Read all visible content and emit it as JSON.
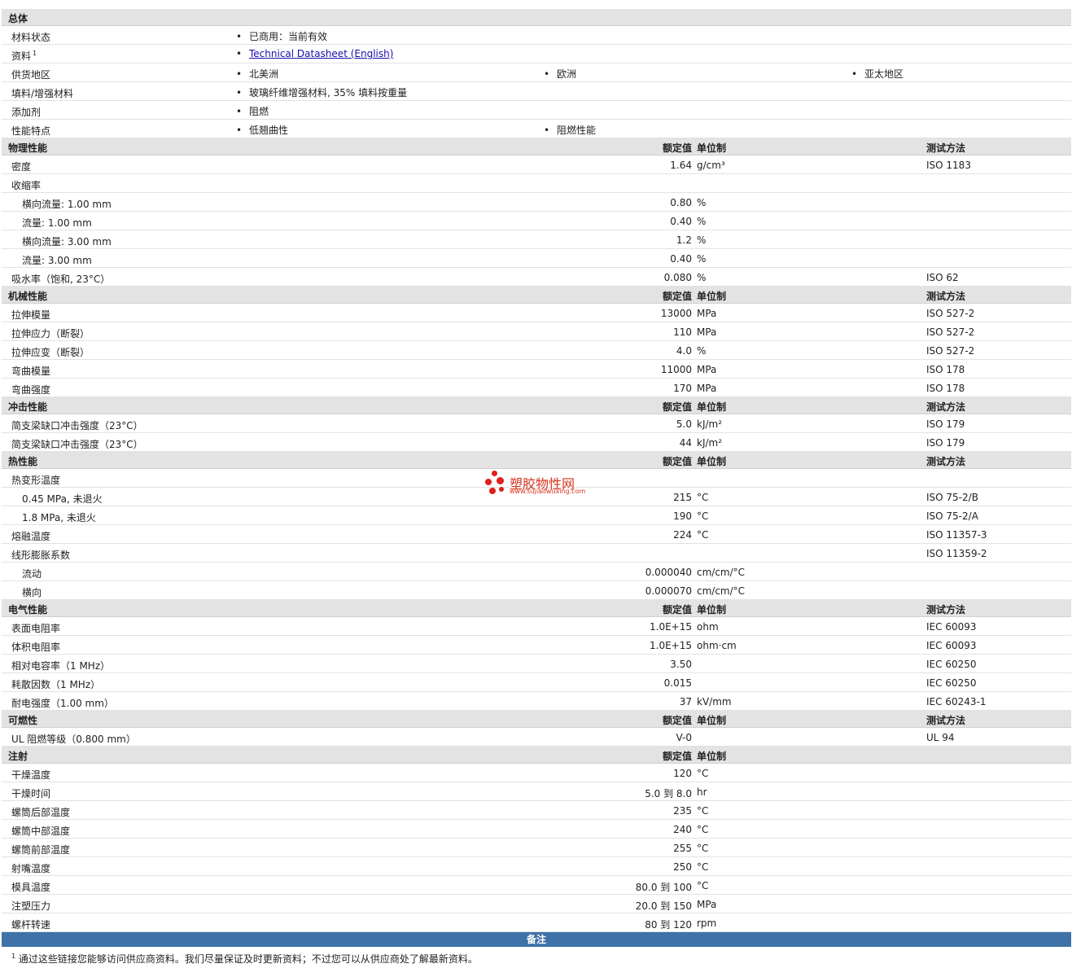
{
  "general": {
    "section": "总体",
    "status_label": "材料状态",
    "status_value": "已商用：当前有效",
    "doc_label": "资料",
    "doc_sup": "1",
    "doc_link": "Technical Datasheet (English)",
    "region_label": "供货地区",
    "regions": [
      "北美洲",
      "欧洲",
      "亚太地区"
    ],
    "filler_label": "填料/增强材料",
    "filler_value": "玻璃纤维增强材料, 35% 填料按重量",
    "additive_label": "添加剂",
    "additive_value": "阻燃",
    "feature_label": "性能特点",
    "features": [
      "低翘曲性",
      "阻燃性能"
    ]
  },
  "headers": {
    "value": "额定值",
    "unit": "单位制",
    "method": "测试方法"
  },
  "physical": {
    "section": "物理性能",
    "rows": [
      {
        "label": "密度",
        "value": "1.64",
        "unit": "g/cm³",
        "method": "ISO 1183"
      },
      {
        "label": "收缩率",
        "value": "",
        "unit": "",
        "method": ""
      },
      {
        "label": "横向流量: 1.00 mm",
        "value": "0.80",
        "unit": "%",
        "method": ""
      },
      {
        "label": "流量: 1.00 mm",
        "value": "0.40",
        "unit": "%",
        "method": ""
      },
      {
        "label": "横向流量: 3.00 mm",
        "value": "1.2",
        "unit": "%",
        "method": ""
      },
      {
        "label": "流量: 3.00 mm",
        "value": "0.40",
        "unit": "%",
        "method": ""
      },
      {
        "label": "吸水率（饱和, 23°C）",
        "value": "0.080",
        "unit": "%",
        "method": "ISO 62"
      }
    ]
  },
  "mechanical": {
    "section": "机械性能",
    "rows": [
      {
        "label": "拉伸模量",
        "value": "13000",
        "unit": "MPa",
        "method": "ISO 527-2"
      },
      {
        "label": "拉伸应力（断裂）",
        "value": "110",
        "unit": "MPa",
        "method": "ISO 527-2"
      },
      {
        "label": "拉伸应变（断裂）",
        "value": "4.0",
        "unit": "%",
        "method": "ISO 527-2"
      },
      {
        "label": "弯曲模量",
        "value": "11000",
        "unit": "MPa",
        "method": "ISO 178"
      },
      {
        "label": "弯曲强度",
        "value": "170",
        "unit": "MPa",
        "method": "ISO 178"
      }
    ]
  },
  "impact": {
    "section": "冲击性能",
    "rows": [
      {
        "label": "简支梁缺口冲击强度（23°C）",
        "value": "5.0",
        "unit": "kJ/m²",
        "method": "ISO 179"
      },
      {
        "label": "简支梁缺口冲击强度（23°C）",
        "value": "44",
        "unit": "kJ/m²",
        "method": "ISO 179"
      }
    ]
  },
  "thermal": {
    "section": "热性能",
    "rows": [
      {
        "label": "热变形温度",
        "value": "",
        "unit": "",
        "method": ""
      },
      {
        "label": "0.45 MPa, 未退火",
        "value": "215",
        "unit": "°C",
        "method": "ISO 75-2/B"
      },
      {
        "label": "1.8 MPa, 未退火",
        "value": "190",
        "unit": "°C",
        "method": "ISO 75-2/A"
      },
      {
        "label": "熔融温度",
        "value": "224",
        "unit": "°C",
        "method": "ISO 11357-3"
      },
      {
        "label": "线形膨胀系数",
        "value": "",
        "unit": "",
        "method": "ISO 11359-2"
      },
      {
        "label": "流动",
        "value": "0.000040",
        "unit": "cm/cm/°C",
        "method": ""
      },
      {
        "label": "横向",
        "value": "0.000070",
        "unit": "cm/cm/°C",
        "method": ""
      }
    ]
  },
  "electrical": {
    "section": "电气性能",
    "rows": [
      {
        "label": "表面电阻率",
        "value": "1.0E+15",
        "unit": "ohm",
        "method": "IEC 60093"
      },
      {
        "label": "体积电阻率",
        "value": "1.0E+15",
        "unit": "ohm·cm",
        "method": "IEC 60093"
      },
      {
        "label": "相对电容率（1 MHz）",
        "value": "3.50",
        "unit": "",
        "method": "IEC 60250"
      },
      {
        "label": "耗散因数（1 MHz）",
        "value": "0.015",
        "unit": "",
        "method": "IEC 60250"
      },
      {
        "label": "耐电强度（1.00 mm）",
        "value": "37",
        "unit": "kV/mm",
        "method": "IEC 60243-1"
      }
    ]
  },
  "flammability": {
    "section": "可燃性",
    "rows": [
      {
        "label": "UL 阻燃等级（0.800 mm）",
        "value": "V-0",
        "unit": "",
        "method": "UL 94"
      }
    ]
  },
  "injection": {
    "section": "注射",
    "rows": [
      {
        "label": "干燥温度",
        "value": "120",
        "unit": "°C"
      },
      {
        "label": "干燥时间",
        "value": "5.0 到  8.0",
        "unit": "hr"
      },
      {
        "label": "螺筒后部温度",
        "value": "235",
        "unit": "°C"
      },
      {
        "label": "螺筒中部温度",
        "value": "240",
        "unit": "°C"
      },
      {
        "label": "螺筒前部温度",
        "value": "255",
        "unit": "°C"
      },
      {
        "label": "射嘴温度",
        "value": "250",
        "unit": "°C"
      },
      {
        "label": "模具温度",
        "value": "80.0 到  100",
        "unit": "°C"
      },
      {
        "label": "注塑压力",
        "value": "20.0 到  150",
        "unit": "MPa"
      },
      {
        "label": "螺杆转速",
        "value": "80 到  120",
        "unit": "rpm"
      }
    ]
  },
  "notes": {
    "title": "备注",
    "sup": "1",
    "text": "通过这些链接您能够访问供应商资料。我们尽量保证及时更新资料；不过您可以从供应商处了解最新资料。"
  },
  "watermark": {
    "title": "塑胶物性网",
    "url": "www.sujiaowuxing.com"
  }
}
